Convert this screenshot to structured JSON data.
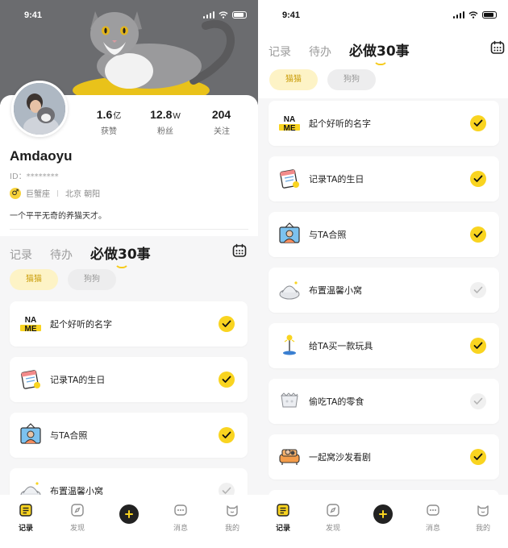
{
  "left": {
    "status": {
      "time": "9:41"
    },
    "profile": {
      "username": "Amdaoyu",
      "id_text": "ID：********",
      "zodiac": "巨蟹座",
      "location": "北京 朝阳",
      "bio": "一个平平无奇的养猫天才。",
      "stats": [
        {
          "value": "1.6",
          "unit": "亿",
          "label": "获赞"
        },
        {
          "value": "12.8",
          "unit": "W",
          "label": "粉丝"
        },
        {
          "value": "204",
          "unit": "",
          "label": "关注"
        }
      ]
    }
  },
  "right": {
    "status": {
      "time": "9:41"
    }
  },
  "tabs": [
    "记录",
    "待办",
    "必做30事"
  ],
  "chips": [
    "猫猫",
    "狗狗"
  ],
  "items": [
    {
      "label": "起个好听的名字",
      "icon": "name-tag-icon",
      "done": true
    },
    {
      "label": "记录TA的生日",
      "icon": "calendar-icon",
      "done": true
    },
    {
      "label": "与TA合照",
      "icon": "photo-icon",
      "done": true
    },
    {
      "label": "布置温馨小窝",
      "icon": "cat-bed-icon",
      "done": false
    },
    {
      "label": "给TA买一款玩具",
      "icon": "toy-icon",
      "done": true
    },
    {
      "label": "偷吃TA的零食",
      "icon": "snack-icon",
      "done": false
    },
    {
      "label": "一起窝沙发看剧",
      "icon": "sofa-icon",
      "done": true
    }
  ],
  "nav": [
    "记录",
    "发现",
    "消息",
    "我的"
  ],
  "colors": {
    "accent": "#f9d420",
    "chip_on_bg": "#fdf3c6",
    "chip_on_text": "#c99c07"
  }
}
